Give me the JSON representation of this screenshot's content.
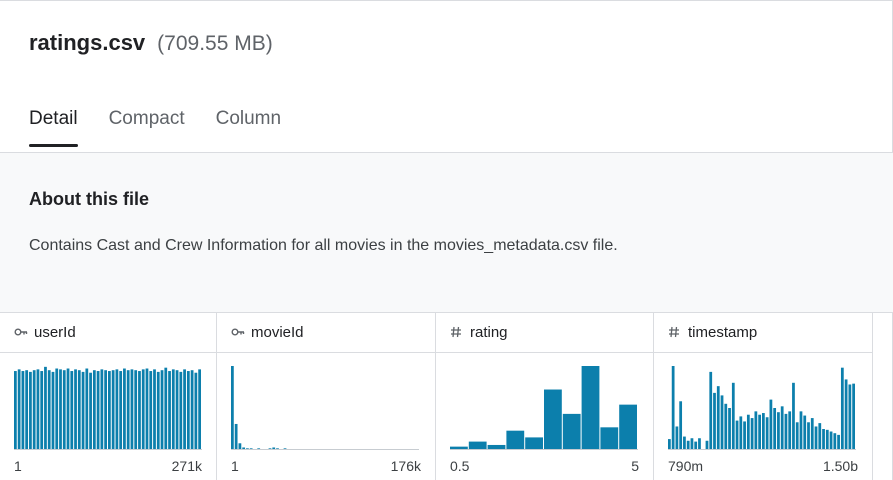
{
  "file": {
    "name": "ratings.csv",
    "size": "(709.55 MB)"
  },
  "tabs": [
    {
      "label": "Detail",
      "active": true
    },
    {
      "label": "Compact",
      "active": false
    },
    {
      "label": "Column",
      "active": false
    }
  ],
  "about": {
    "heading": "About this file",
    "description": "Contains Cast and Crew Information for all movies in the movies_metadata.csv file."
  },
  "colors": {
    "bar": "#0c7fac",
    "accent_underline": "#202124"
  },
  "columns": [
    {
      "name": "userId",
      "icon": "key-icon",
      "min": "1",
      "max": "271k",
      "bars": [
        0.94,
        0.96,
        0.94,
        0.95,
        0.93,
        0.95,
        0.96,
        0.94,
        0.99,
        0.95,
        0.93,
        0.97,
        0.96,
        0.95,
        0.97,
        0.94,
        0.96,
        0.95,
        0.93,
        0.97,
        0.92,
        0.95,
        0.94,
        0.96,
        0.95,
        0.94,
        0.95,
        0.96,
        0.94,
        0.97,
        0.95,
        0.96,
        0.95,
        0.94,
        0.96,
        0.97,
        0.94,
        0.96,
        0.93,
        0.95,
        0.98,
        0.94,
        0.96,
        0.95,
        0.93,
        0.96,
        0.94,
        0.95,
        0.92,
        0.96
      ]
    },
    {
      "name": "movieId",
      "icon": "key-icon",
      "min": "1",
      "max": "176k",
      "bars": [
        1.0,
        0.31,
        0.08,
        0.03,
        0.02,
        0.02,
        0.01,
        0.02,
        0.01,
        0.01,
        0.02,
        0.03,
        0.02,
        0.01,
        0.02,
        0.01,
        0.01,
        0.01,
        0.01,
        0.01,
        0.01,
        0.01,
        0.01,
        0.01,
        0.01,
        0.01,
        0.01,
        0.01,
        0.01,
        0.01,
        0.01,
        0.01,
        0.01,
        0.01,
        0.01,
        0.01,
        0.01,
        0.01,
        0.01,
        0.01,
        0.01,
        0.01,
        0.01,
        0.01,
        0.01,
        0.01,
        0.01,
        0.01,
        0.01,
        0.01
      ]
    },
    {
      "name": "rating",
      "icon": "hash-icon",
      "min": "0.5",
      "max": "5",
      "bars": [
        0.04,
        0.1,
        0.06,
        0.23,
        0.15,
        0.72,
        0.43,
        1.0,
        0.27,
        0.54
      ]
    },
    {
      "name": "timestamp",
      "icon": "hash-icon",
      "min": "790m",
      "max": "1.50b",
      "bars": [
        0.13,
        1.0,
        0.28,
        0.58,
        0.16,
        0.11,
        0.14,
        0.1,
        0.14,
        0.01,
        0.11,
        0.93,
        0.68,
        0.76,
        0.65,
        0.55,
        0.5,
        0.8,
        0.35,
        0.4,
        0.34,
        0.42,
        0.38,
        0.46,
        0.42,
        0.44,
        0.39,
        0.6,
        0.5,
        0.45,
        0.52,
        0.43,
        0.46,
        0.8,
        0.33,
        0.46,
        0.41,
        0.33,
        0.38,
        0.28,
        0.32,
        0.25,
        0.24,
        0.22,
        0.2,
        0.18,
        0.98,
        0.84,
        0.78,
        0.79
      ]
    },
    {
      "name": "",
      "icon": "",
      "min": "",
      "max": "",
      "bars": []
    }
  ]
}
